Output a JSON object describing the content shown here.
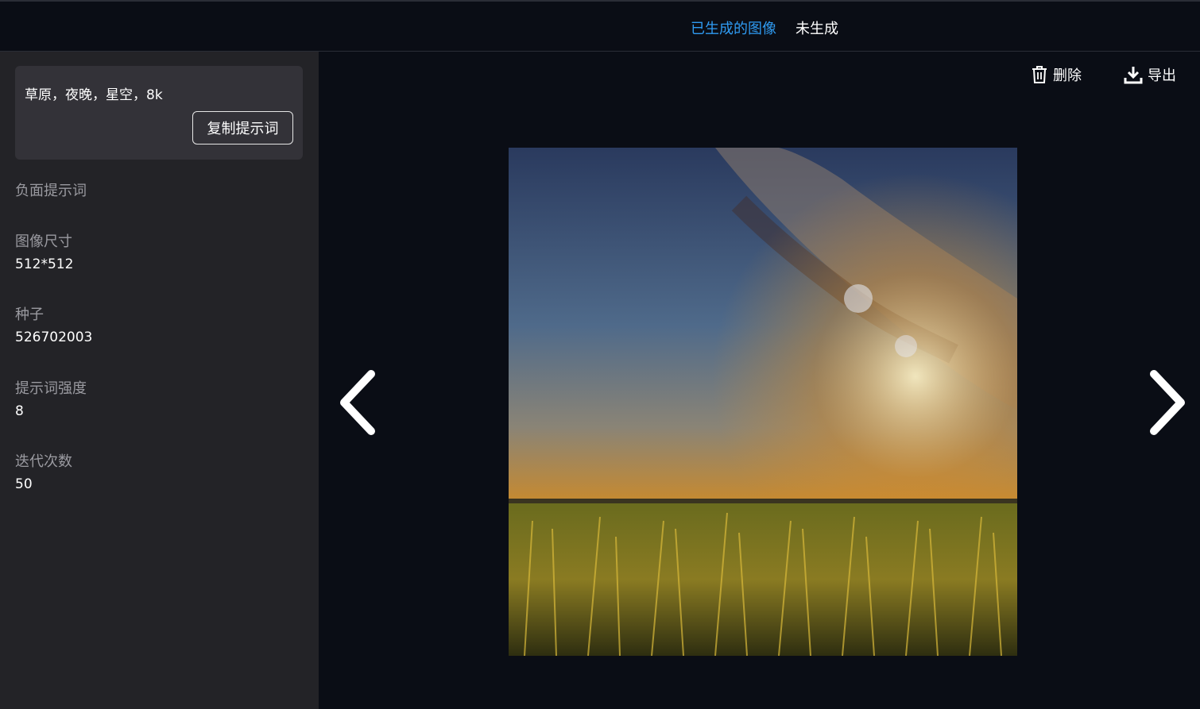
{
  "tabs": [
    {
      "label": "已生成的图像",
      "active": true
    },
    {
      "label": "未生成",
      "active": false
    }
  ],
  "sidebar": {
    "prompt": "草原，夜晚，星空，8k",
    "copy_button": "复制提示词",
    "fields": [
      {
        "label": "负面提示词",
        "value": ""
      },
      {
        "label": "图像尺寸",
        "value": "512*512"
      },
      {
        "label": "种子",
        "value": "526702003"
      },
      {
        "label": "提示词强度",
        "value": "8"
      },
      {
        "label": "迭代次数",
        "value": "50"
      }
    ]
  },
  "actions": {
    "delete_label": "删除",
    "export_label": "导出"
  },
  "icons": {
    "delete": "trash-icon",
    "export": "download-icon",
    "prev": "chevron-left-icon",
    "next": "chevron-right-icon"
  },
  "colors": {
    "accent": "#2f9bf2",
    "background": "#0a0d15",
    "sidebar": "#232327"
  }
}
